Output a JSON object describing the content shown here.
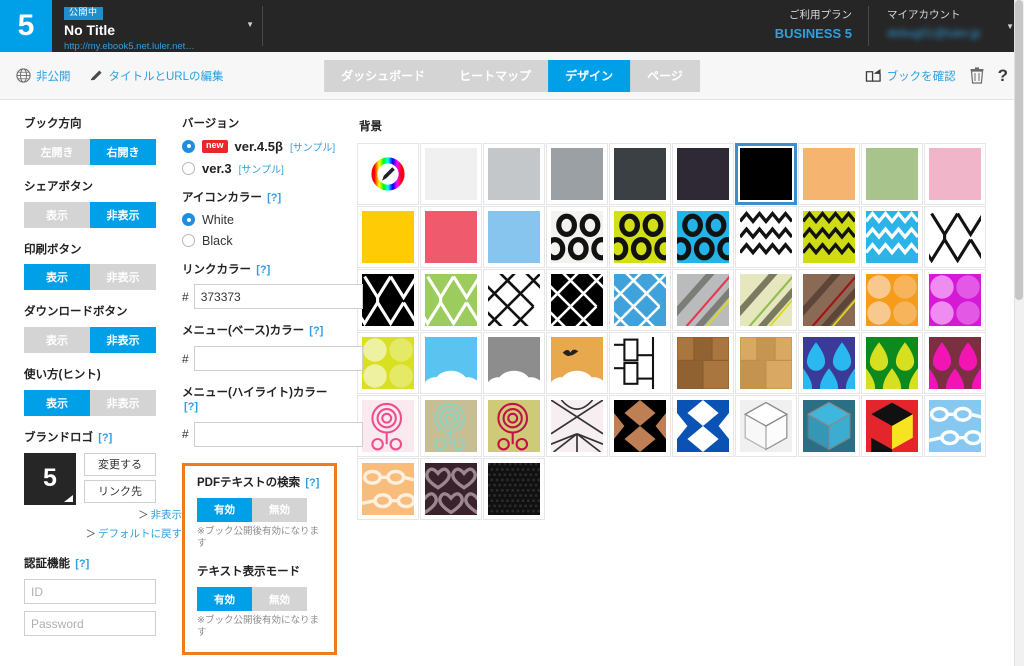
{
  "header": {
    "brand_number": "5",
    "publish_badge": "公開中",
    "book_title": "No Title",
    "book_url": "http://my.ebook5.net.luler.net…",
    "caret": "▼",
    "plan_label": "ご利用プラン",
    "plan_value": "BUSINESS 5",
    "account_label": "マイアカウント",
    "account_value": "debug01@luler.jp",
    "account_caret": "▼"
  },
  "toolbar": {
    "private_label": "非公開",
    "edit_label": "タイトルとURLの編集",
    "tabs": [
      {
        "label": "ダッシュボード",
        "active": false
      },
      {
        "label": "ヒートマップ",
        "active": false
      },
      {
        "label": "デザイン",
        "active": true
      },
      {
        "label": "ページ",
        "active": false
      }
    ],
    "preview_label": "ブックを確認",
    "help_label": "?"
  },
  "sidebar": {
    "book_direction": {
      "label": "ブック方向",
      "options": [
        "左開き",
        "右開き"
      ],
      "selected": 1
    },
    "share_button": {
      "label": "シェアボタン",
      "options": [
        "表示",
        "非表示"
      ],
      "selected": 1
    },
    "print_button": {
      "label": "印刷ボタン",
      "options": [
        "表示",
        "非表示"
      ],
      "selected": 0
    },
    "download_button": {
      "label": "ダウンロードボタン",
      "options": [
        "表示",
        "非表示"
      ],
      "selected": 1
    },
    "usage_hint": {
      "label": "使い方(ヒント)",
      "options": [
        "表示",
        "非表示"
      ],
      "selected": 0
    },
    "brand_logo": {
      "label": "ブランドロゴ",
      "hint": "[?]",
      "thumb_text": "5",
      "change_label": "変更する",
      "link_label": "リンク先",
      "hide_link": "非表示",
      "reset_link": "デフォルトに戻す",
      "arrow": "＞"
    },
    "auth": {
      "label": "認証機能",
      "hint": "[?]",
      "id_placeholder": "ID",
      "id_value": "",
      "password_placeholder": "Password",
      "password_value": ""
    }
  },
  "settings": {
    "version": {
      "label": "バージョン",
      "options": [
        {
          "badge": "new",
          "name": "ver.4.5β",
          "sample": "[サンプル]",
          "selected": true
        },
        {
          "badge": "",
          "name": "ver.3",
          "sample": "[サンプル]",
          "selected": false
        }
      ]
    },
    "icon_color": {
      "label": "アイコンカラー",
      "hint": "[?]",
      "options": [
        {
          "name": "White",
          "selected": true
        },
        {
          "name": "Black",
          "selected": false
        }
      ]
    },
    "link_color": {
      "label": "リンクカラー",
      "hint": "[?]",
      "hash": "#",
      "value": "373373"
    },
    "menu_base_color": {
      "label": "メニュー(ベース)カラー",
      "hint": "[?]",
      "hash": "#",
      "value": ""
    },
    "menu_highlight_color": {
      "label": "メニュー(ハイライト)カラー",
      "hint": "[?]",
      "hash": "#",
      "value": ""
    },
    "pdf_text_search": {
      "label": "PDFテキストの検索",
      "hint": "[?]",
      "options": [
        "有効",
        "無効"
      ],
      "selected": 0,
      "note": "※ブック公開後有効になります"
    },
    "text_display_mode": {
      "label": "テキスト表示モード",
      "hint": "",
      "options": [
        "有効",
        "無効"
      ],
      "selected": 0,
      "note": "※ブック公開後有効になります"
    }
  },
  "background": {
    "title": "背景",
    "columns": 10,
    "selected_index": 6,
    "swatches": [
      {
        "name": "color-picker",
        "kind": "picker"
      },
      {
        "name": "white",
        "kind": "solid",
        "color": "#f0f0f0"
      },
      {
        "name": "light-gray",
        "kind": "solid",
        "color": "#c3c7ca"
      },
      {
        "name": "gray",
        "kind": "solid",
        "color": "#9ba0a4"
      },
      {
        "name": "dark-slate",
        "kind": "solid",
        "color": "#3b4044"
      },
      {
        "name": "dark-plum",
        "kind": "solid",
        "color": "#2e2935"
      },
      {
        "name": "black",
        "kind": "solid",
        "color": "#000000"
      },
      {
        "name": "orange",
        "kind": "solid",
        "color": "#f5b570"
      },
      {
        "name": "sage-green",
        "kind": "solid",
        "color": "#a8c48c"
      },
      {
        "name": "pink",
        "kind": "solid",
        "color": "#f0b5c8"
      },
      {
        "name": "yellow",
        "kind": "solid",
        "color": "#ffcb05"
      },
      {
        "name": "rose-red",
        "kind": "solid",
        "color": "#ef5a6d"
      },
      {
        "name": "sky-blue",
        "kind": "solid",
        "color": "#88c5ee"
      },
      {
        "name": "rings-white",
        "kind": "rings",
        "bg": "#f4f2ee",
        "fg": "#121212"
      },
      {
        "name": "rings-lime",
        "kind": "rings",
        "bg": "#d4e016",
        "fg": "#121212"
      },
      {
        "name": "rings-cyan",
        "kind": "rings",
        "bg": "#22b4e8",
        "fg": "#121212"
      },
      {
        "name": "zigzag-white",
        "kind": "zigzag",
        "bg": "#ffffff",
        "fg": "#121212"
      },
      {
        "name": "zigzag-lime",
        "kind": "zigzag",
        "bg": "#cfdc14",
        "fg": "#121212"
      },
      {
        "name": "zigzag-cyan",
        "kind": "zigzag",
        "bg": "#2bb4e8",
        "fg": "#ffffff"
      },
      {
        "name": "chevron-white",
        "kind": "chevron",
        "bg": "#ffffff",
        "fg": "#121212"
      },
      {
        "name": "chevron-black",
        "kind": "chevron",
        "bg": "#000000",
        "fg": "#ffffff"
      },
      {
        "name": "chevron-green",
        "kind": "chevron",
        "bg": "#9ccc5e",
        "fg": "#ffffff"
      },
      {
        "name": "lattice-white",
        "kind": "lattice",
        "bg": "#ffffff",
        "fg": "#121212"
      },
      {
        "name": "lattice-black",
        "kind": "lattice",
        "bg": "#000000",
        "fg": "#ffffff"
      },
      {
        "name": "lattice-blue",
        "kind": "lattice",
        "bg": "#3fa2da",
        "fg": "#ffffff"
      },
      {
        "name": "stripes-gray-red",
        "kind": "stripes",
        "bg": "#b9bbbd",
        "fg": "#7b7d76",
        "accent": "#e8384f"
      },
      {
        "name": "stripes-olive",
        "kind": "stripes",
        "bg": "#e6e6bf",
        "fg": "#7b7a60",
        "accent": "#8fbf4f"
      },
      {
        "name": "stripes-maroon",
        "kind": "stripes",
        "bg": "#8b6a55",
        "fg": "#5d4638",
        "accent": "#a21319"
      },
      {
        "name": "circles-orange",
        "kind": "circles",
        "bg": "#f59c1a",
        "fg": "#f8c98f"
      },
      {
        "name": "circles-magenta",
        "kind": "circles",
        "bg": "#d51ad5",
        "fg": "#ee8cf0"
      },
      {
        "name": "circles-lime",
        "kind": "circles",
        "bg": "#d9e021",
        "fg": "#eef2a0"
      },
      {
        "name": "clouds-blue",
        "kind": "clouds",
        "bg": "#5bc3ef",
        "fg": "#ffffff"
      },
      {
        "name": "clouds-gray",
        "kind": "clouds",
        "bg": "#8d8d8d",
        "fg": "#ffffff"
      },
      {
        "name": "clouds-orange-bird",
        "kind": "clouds-bird",
        "bg": "#e8a84d",
        "fg": "#ffffff"
      },
      {
        "name": "brick-outline",
        "kind": "brick",
        "bg": "#ffffff",
        "fg": "#121212"
      },
      {
        "name": "wood-dark",
        "kind": "wood",
        "bg": "#a9763f",
        "fg": "#8a5c2e"
      },
      {
        "name": "wood-light",
        "kind": "wood",
        "bg": "#d9a863",
        "fg": "#c08f4b"
      },
      {
        "name": "drops-navy",
        "kind": "drops",
        "bg": "#3b3a98",
        "fg": "#29b8ef"
      },
      {
        "name": "drops-green",
        "kind": "drops",
        "bg": "#0d8a1e",
        "fg": "#d6e021"
      },
      {
        "name": "drops-maroon",
        "kind": "drops",
        "bg": "#7a3040",
        "fg": "#f215b4"
      },
      {
        "name": "rose-pink",
        "kind": "rose",
        "bg": "#fbe9f0",
        "fg": "#ef4e8e"
      },
      {
        "name": "rose-mint",
        "kind": "rose",
        "bg": "#c7bf93",
        "fg": "#8ed2c4"
      },
      {
        "name": "rose-crimson",
        "kind": "rose",
        "bg": "#cfca78",
        "fg": "#c21048"
      },
      {
        "name": "burst-white",
        "kind": "burst",
        "bg": "#f7eef1",
        "fg": "#333333"
      },
      {
        "name": "diamond-brown",
        "kind": "diamond",
        "bg": "#000000",
        "fg": "#bd7f53"
      },
      {
        "name": "diamond-blue",
        "kind": "diamond",
        "bg": "#0b52b5",
        "fg": "#ffffff"
      },
      {
        "name": "cube-white",
        "kind": "cube",
        "bg": "#f0f0f0",
        "fg": "#ffffff"
      },
      {
        "name": "cube-teal",
        "kind": "cube",
        "bg": "#2a6f86",
        "fg": "#3fb6dd"
      },
      {
        "name": "cube-red-yellow",
        "kind": "cube-tri",
        "bg": "#e4262c",
        "fg": "#f7e420"
      },
      {
        "name": "glasses-blue",
        "kind": "glasses",
        "bg": "#86c8f0",
        "fg": "#ffffff"
      },
      {
        "name": "glasses-orange",
        "kind": "glasses",
        "bg": "#f8bd7c",
        "fg": "#fdf0de"
      },
      {
        "name": "hearts-plum",
        "kind": "hearts",
        "bg": "#3a222c",
        "fg": "#9c8790"
      },
      {
        "name": "carbon-black",
        "kind": "carbon",
        "bg": "#101010",
        "fg": "#2b2b2b"
      }
    ]
  }
}
